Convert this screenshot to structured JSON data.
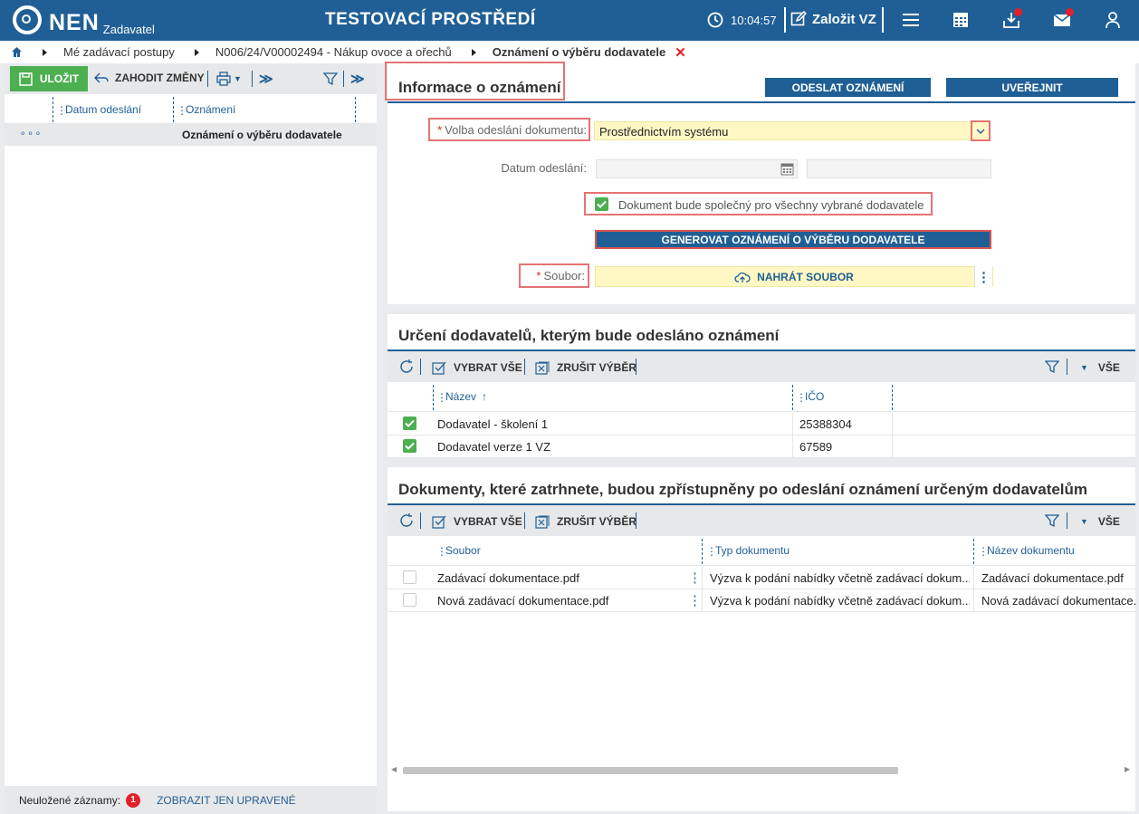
{
  "topbar": {
    "logo": "NEN",
    "logo_sub": "Zadavatel",
    "env_title": "TESTOVACÍ PROSTŘEDÍ",
    "time": "10:04:57",
    "create_label": "Založit VZ",
    "bg_color": "#1f5f96"
  },
  "breadcrumb": {
    "items": [
      "Mé zadávací postupy",
      "N006/24/V00002494 - Nákup ovoce a ořechů",
      "Oznámení o výběru dodavatele"
    ]
  },
  "left_panel": {
    "toolbar": {
      "save": "ULOŽIT",
      "discard": "ZAHODIT ZMĚNY"
    },
    "columns": [
      "Datum odeslání",
      "Oznámení"
    ],
    "row": {
      "dots": "⚬⚬⚬",
      "value": "Oznámení o výběru dodavatele"
    },
    "footer": {
      "unsaved_label": "Neuložené záznamy:",
      "unsaved_count": "1",
      "show_only": "ZOBRAZIT JEN UPRAVENÉ"
    }
  },
  "info": {
    "title": "Informace o oznámení",
    "send_btn": "ODESLAT OZNÁMENÍ",
    "publish_btn": "UVEŘEJNIT",
    "send_mode_label": "Volba odeslání dokumentu:",
    "send_mode_value": "Prostřednictvím systému",
    "date_label": "Datum odeslání:",
    "common_doc_label": "Dokument bude společný pro všechny vybrané dodavatele",
    "generate_btn": "GENEROVAT OZNÁMENÍ O VÝBĚRU DODAVATELE",
    "file_label": "Soubor:",
    "upload_btn": "NAHRÁT SOUBOR"
  },
  "suppliers": {
    "title": "Určení dodavatelů, kterým bude odesláno oznámení",
    "select_all": "VYBRAT VŠE",
    "cancel_selection": "ZRUŠIT VÝBĚR",
    "all": "VŠE",
    "columns": [
      "Název",
      "IČO"
    ],
    "rows": [
      {
        "name": "Dodavatel - školení 1",
        "ico": "25388304",
        "checked": true
      },
      {
        "name": "Dodavatel verze 1 VZ",
        "ico": "67589",
        "checked": true
      }
    ]
  },
  "documents": {
    "title": "Dokumenty, které zatrhnete, budou zpřístupněny po odeslání oznámení určeným dodavatelům",
    "select_all": "VYBRAT VŠE",
    "cancel_selection": "ZRUŠIT VÝBĚR",
    "all": "VŠE",
    "columns": [
      "Soubor",
      "Typ dokumentu",
      "Název dokumentu"
    ],
    "rows": [
      {
        "file": "Zadávací dokumentace.pdf",
        "type": "Výzva k podání nabídky včetně zadávací dokum...",
        "name": "Zadávací dokumentace.pdf",
        "checked": false
      },
      {
        "file": "Nová zadávací dokumentace.pdf",
        "type": "Výzva k podání nabídky včetně zadávací dokum...",
        "name": "Nová zadávací dokumentace.p",
        "checked": false
      }
    ]
  }
}
